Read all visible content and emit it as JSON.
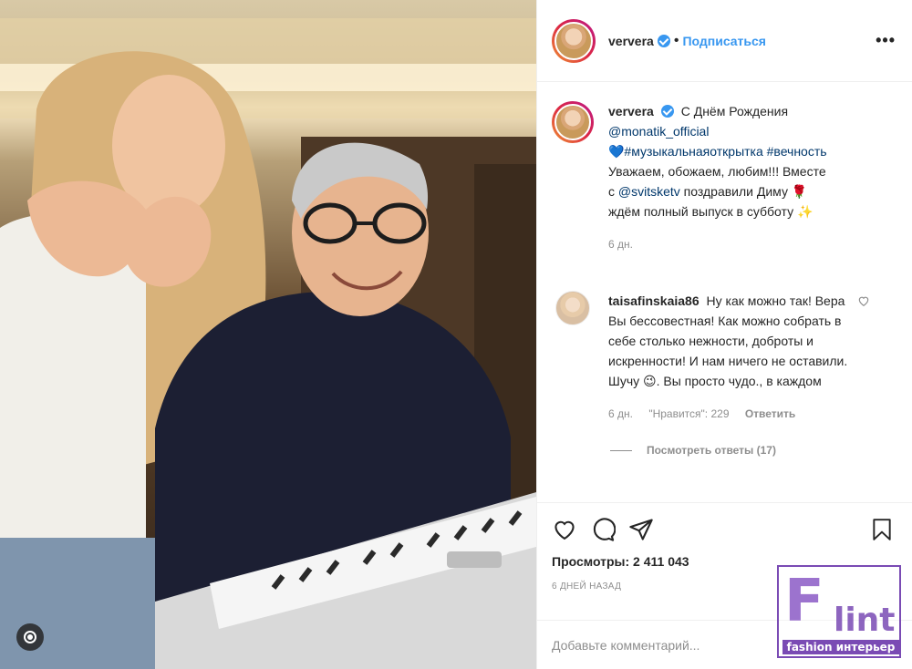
{
  "post": {
    "author": "ververa",
    "follow_label": "Подписаться",
    "more_label": "•••"
  },
  "caption": {
    "username": "ververa",
    "line1": "С Днём Рождения",
    "mention1": "@monatik_official",
    "hashtags": "💙#музыкальнаяоткрытка #вечность",
    "line3": "Уважаем, обожаем, любим!!! Вместе",
    "line4_prefix": "с ",
    "mention2": "@svitsketv",
    "line4_suffix": " поздравили Диму 🌹",
    "line5": "ждём полный выпуск в субботу ✨",
    "age": "6 дн."
  },
  "comment": {
    "username": "taisafinskaia86",
    "text": "Ну как можно так! Вера Вы бессовестная! Как можно собрать в себе столько нежности, доброты и искренности! И нам ничего не оставили. Шучу 😉. Вы просто чудо., в каждом",
    "age": "6 дн.",
    "likes": "\"Нравится\": 229",
    "reply_label": "Ответить"
  },
  "view_replies": "Посмотреть ответы (17)",
  "stats": {
    "views": "Просмотры: 2 411 043",
    "date": "6 дней назад"
  },
  "add_comment": {
    "placeholder": "Добавьте комментарий..."
  },
  "watermark": {
    "logo": "F",
    "logo2": "lint",
    "tagline": "fashion интерьер"
  },
  "colors": {
    "accent": "#3897f0",
    "text": "#262626",
    "muted": "#8e8e8e",
    "watermark": "#7a4bb4"
  },
  "icons": [
    "heart-icon",
    "comment-icon",
    "share-icon",
    "bookmark-icon",
    "more-icon",
    "verified-icon",
    "media-glyph-icon"
  ]
}
